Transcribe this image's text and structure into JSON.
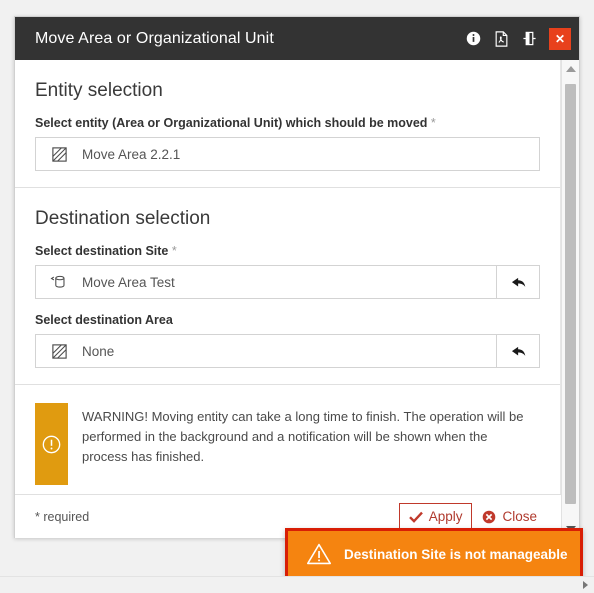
{
  "dialog": {
    "title": "Move Area or Organizational Unit",
    "titlebar_icons": [
      {
        "name": "info-icon",
        "label": "Info"
      },
      {
        "name": "pdf-export-icon",
        "label": "Export to PDF"
      },
      {
        "name": "resize-window-icon",
        "label": "Resize"
      }
    ],
    "close_label": "✕"
  },
  "entity_section": {
    "heading": "Entity selection",
    "field_label": "Select entity (Area or Organizational Unit) which should be moved",
    "required_marker": "*",
    "value": "Move Area 2.2.1",
    "icon": "area-icon"
  },
  "destination_section": {
    "heading": "Destination selection",
    "site": {
      "label": "Select destination Site",
      "required_marker": "*",
      "value": "Move Area Test",
      "icon": "site-icon",
      "undo_icon": "undo-arrow-icon"
    },
    "area": {
      "label": "Select destination Area",
      "required_marker": "",
      "value": "None",
      "icon": "area-icon",
      "undo_icon": "undo-arrow-icon"
    }
  },
  "warning": {
    "icon": "exclamation-circle-icon",
    "text": "WARNING! Moving entity can take a long time to finish. The operation will be performed in the background and a notification will be shown when the process has finished.",
    "bar_color": "#e09b10"
  },
  "footer": {
    "required_note": "* required",
    "apply_label": "Apply",
    "apply_icon": "check-icon",
    "close_label": "Close",
    "close_icon": "circle-x-icon",
    "accent_color": "#c0392b"
  },
  "toast": {
    "message": "Destination Site is not manageable",
    "icon": "warning-triangle-icon",
    "background": "#f58410",
    "border_color": "#d81e05"
  },
  "scrollbars": {
    "vertical": {
      "up_icon": "triangle-up-icon",
      "down_icon": "triangle-down-icon",
      "thumb": "scroll-thumb"
    },
    "horizontal": {
      "right_icon": "triangle-right-icon"
    }
  }
}
